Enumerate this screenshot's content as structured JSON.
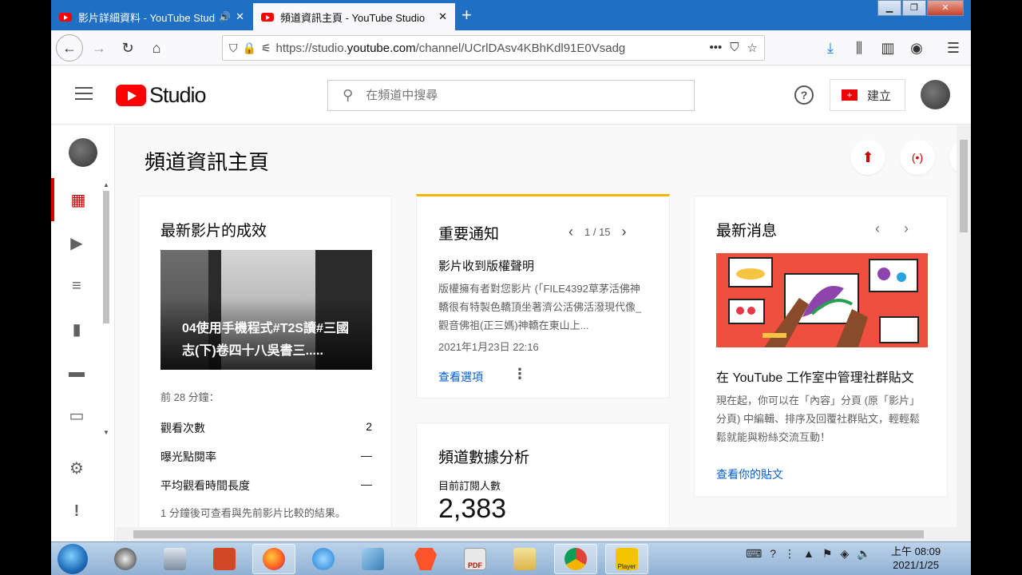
{
  "browser": {
    "tabs": [
      {
        "title": "影片詳細資料 - YouTube Studio",
        "active": false
      },
      {
        "title": "頻道資訊主頁 - YouTube Studio",
        "active": true
      }
    ],
    "url_prefix": "https://studio.",
    "url_domain": "youtube.com",
    "url_path": "/channel/UCrlDAsv4KBhKdl91E0Vsadg",
    "more": "•••"
  },
  "studio": {
    "logo_text": "Studio",
    "search_placeholder": "在頻道中搜尋",
    "help_label": "?",
    "create_label": "建立"
  },
  "sidebar": {
    "items": [
      {
        "icon": "dashboard-icon",
        "glyph": "▦",
        "active": true
      },
      {
        "icon": "content-icon",
        "glyph": "▶",
        "active": false
      },
      {
        "icon": "playlists-icon",
        "glyph": "≡",
        "active": false
      },
      {
        "icon": "analytics-icon",
        "glyph": "▮",
        "active": false
      },
      {
        "icon": "comments-icon",
        "glyph": "▬",
        "active": false
      },
      {
        "icon": "subtitles-icon",
        "glyph": "▭",
        "active": false
      },
      {
        "icon": "settings-icon",
        "glyph": "⚙",
        "active": false
      },
      {
        "icon": "feedback-icon",
        "glyph": "!",
        "active": false
      }
    ]
  },
  "page": {
    "title": "頻道資訊主頁"
  },
  "latest_video": {
    "heading": "最新影片的成效",
    "video_title": "04使用手機程式#T2S讀#三國志(下)卷四十八吳書三.....",
    "period": "前 28 分鐘：",
    "metrics": [
      {
        "label": "觀看次數",
        "value": "2"
      },
      {
        "label": "曝光點閱率",
        "value": "—"
      },
      {
        "label": "平均觀看時間長度",
        "value": "—"
      }
    ],
    "note": "1 分鐘後可查看與先前影片比較的結果。"
  },
  "notices": {
    "heading": "重要通知",
    "pager": "1 / 15",
    "item_title": "影片收到版權聲明",
    "item_body": "版權擁有者對您影片 (「FILE4392草茅活佛神轎很有特製色轎頂坐著濟公活佛活潑現代像_觀音佛祖(正三媽)神轎在東山上...",
    "item_date": "2021年1月23日 22:16",
    "link": "查看選項"
  },
  "analytics": {
    "heading": "頻道數據分析",
    "sub_label": "目前訂閱人數",
    "subscribers": "2,383"
  },
  "news": {
    "heading": "最新消息",
    "title": "在 YouTube 工作室中管理社群貼文",
    "body": "現在起，你可以在「內容」分頁 (原「影片」分頁) 中編輯、排序及回覆社群貼文，輕輕鬆鬆就能與粉絲交流互動！",
    "link": "查看你的貼文"
  },
  "taskbar": {
    "time": "上午 08:09",
    "date": "2021/1/25",
    "player_label": "Player",
    "pdf_label": "PDF"
  }
}
